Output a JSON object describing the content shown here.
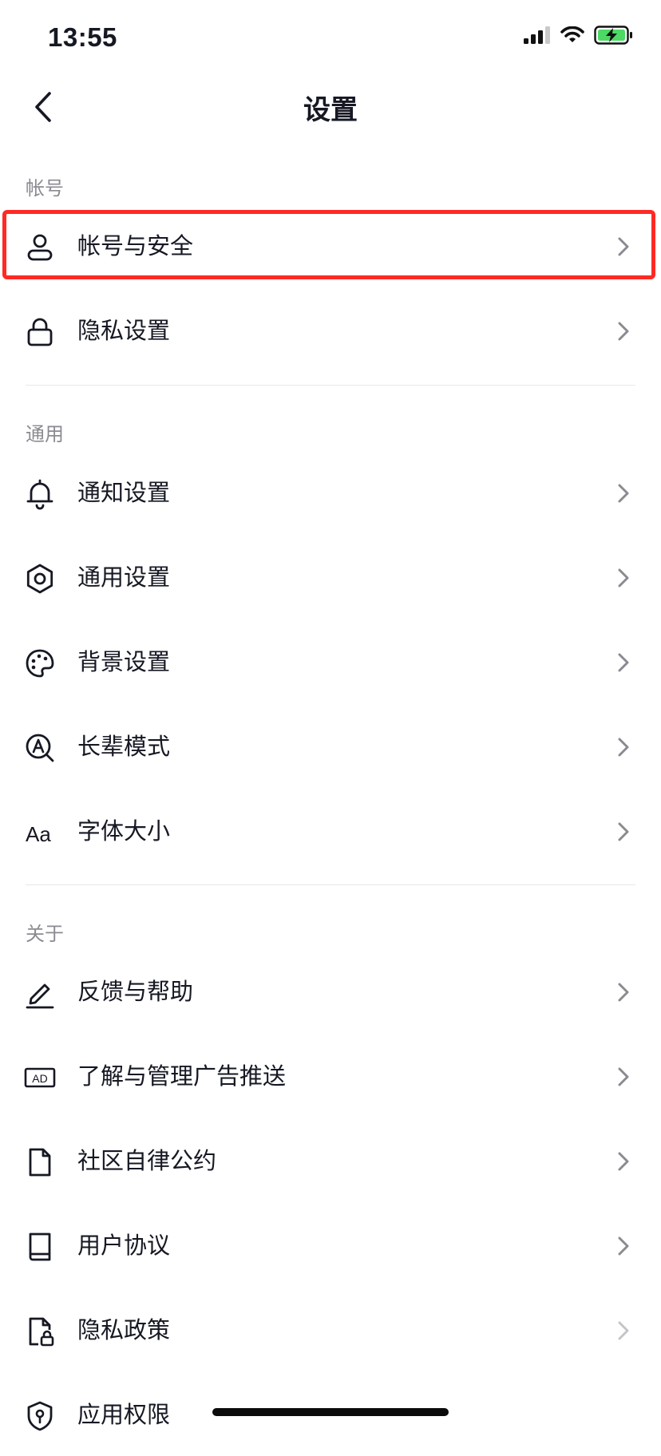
{
  "status_bar": {
    "time": "13:55"
  },
  "nav": {
    "title": "设置"
  },
  "sections": [
    {
      "label": "帐号"
    },
    {
      "label": "通用"
    },
    {
      "label": "关于"
    }
  ],
  "items": [
    {
      "label": "帐号与安全",
      "icon": "person-icon"
    },
    {
      "label": "隐私设置",
      "icon": "lock-icon"
    },
    {
      "label": "通知设置",
      "icon": "bell-icon"
    },
    {
      "label": "通用设置",
      "icon": "gear-icon"
    },
    {
      "label": "背景设置",
      "icon": "palette-icon"
    },
    {
      "label": "长辈模式",
      "icon": "elder-mode-icon"
    },
    {
      "label": "字体大小",
      "icon": "font-size-icon",
      "icon_text": "Aa"
    },
    {
      "label": "反馈与帮助",
      "icon": "pencil-icon"
    },
    {
      "label": "了解与管理广告推送",
      "icon": "ad-icon",
      "icon_text": "AD"
    },
    {
      "label": "社区自律公约",
      "icon": "document-icon"
    },
    {
      "label": "用户协议",
      "icon": "book-icon"
    },
    {
      "label": "隐私政策",
      "icon": "privacy-policy-icon"
    },
    {
      "label": "应用权限",
      "icon": "shield-icon"
    }
  ],
  "colors": {
    "highlight": "#ff2a24",
    "text": "#161823",
    "muted": "#8a8b91",
    "battery": "#4cd964"
  }
}
